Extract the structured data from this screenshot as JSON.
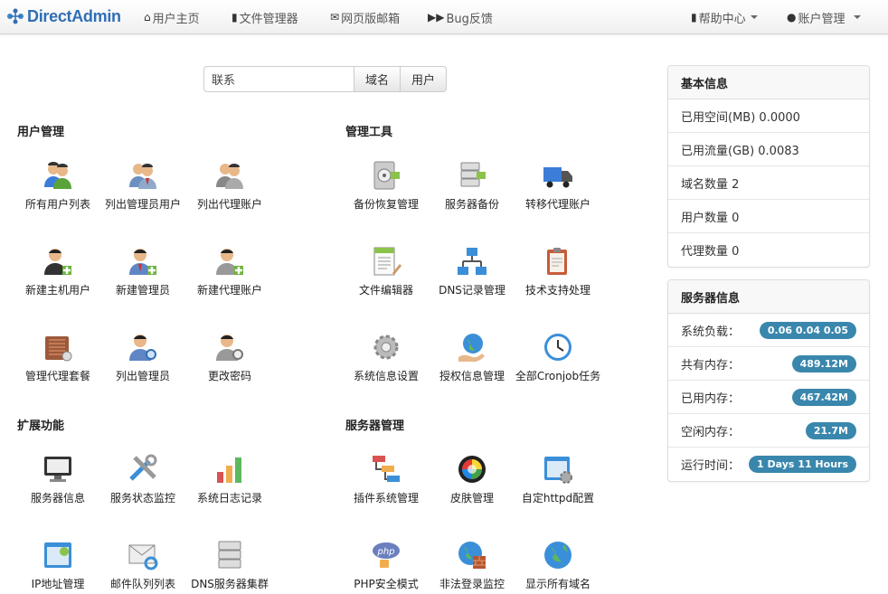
{
  "navbar": {
    "brand": "DirectAdmin",
    "items": [
      {
        "label": "用户主页",
        "icon": "home-icon"
      },
      {
        "label": "文件管理器",
        "icon": "file-icon"
      },
      {
        "label": "网页版邮箱",
        "icon": "envelope-icon"
      },
      {
        "label": "Bug反馈",
        "icon": "forward-icon"
      }
    ],
    "right": [
      {
        "label": "帮助中心",
        "icon": "book-icon"
      },
      {
        "label": "账户管理",
        "icon": "user-icon"
      }
    ]
  },
  "search": {
    "value": "联系",
    "buttons": [
      "域名",
      "用户"
    ]
  },
  "sections": {
    "user_mgmt": {
      "title": "用户管理",
      "items": [
        "所有用户列表",
        "列出管理员用户",
        "列出代理账户",
        "新建主机用户",
        "新建管理员",
        "新建代理账户",
        "管理代理套餐",
        "列出管理员",
        "更改密码"
      ]
    },
    "admin_tools": {
      "title": "管理工具",
      "items": [
        "备份恢复管理",
        "服务器备份",
        "转移代理账户",
        "文件编辑器",
        "DNS记录管理",
        "技术支持处理",
        "系统信息设置",
        "授权信息管理",
        "全部Cronjob任务"
      ]
    },
    "extensions": {
      "title": "扩展功能",
      "items": [
        "服务器信息",
        "服务状态监控",
        "系统日志记录",
        "IP地址管理",
        "邮件队列列表",
        "DNS服务器集群"
      ]
    },
    "server_mgmt": {
      "title": "服务器管理",
      "items": [
        "插件系统管理",
        "皮肤管理",
        "自定httpd配置",
        "PHP安全模式",
        "非法登录监控",
        "显示所有域名"
      ]
    }
  },
  "basic_info": {
    "title": "基本信息",
    "rows": [
      {
        "label": "已用空间(MB)",
        "value": "0.0000"
      },
      {
        "label": "已用流量(GB)",
        "value": "0.0083"
      },
      {
        "label": "域名数量",
        "value": "2"
      },
      {
        "label": "用户数量",
        "value": "0"
      },
      {
        "label": "代理数量",
        "value": "0"
      }
    ]
  },
  "server_info": {
    "title": "服务器信息",
    "rows": [
      {
        "label": "系统负载：",
        "value": "0.06 0.04 0.05"
      },
      {
        "label": "共有内存：",
        "value": "489.12M"
      },
      {
        "label": "已用内存：",
        "value": "467.42M"
      },
      {
        "label": "空闲内存：",
        "value": "21.7M"
      },
      {
        "label": "运行时间：",
        "value": "1 Days 11 Hours"
      }
    ]
  },
  "colors": {
    "brand": "#2f6fb5",
    "badge": "#3a87ad"
  }
}
